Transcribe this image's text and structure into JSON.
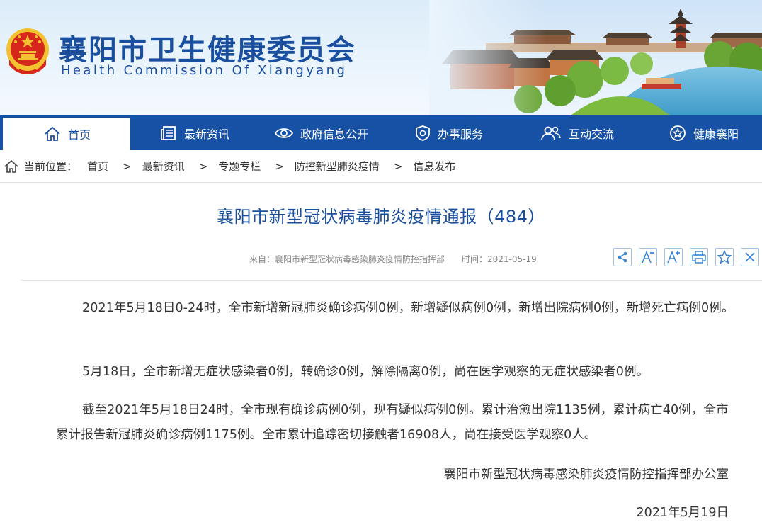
{
  "header": {
    "title": "襄阳市卫生健康委员会",
    "subtitle": "Health Commission Of Xiangyang"
  },
  "nav": {
    "items": [
      {
        "label": "首页",
        "icon": "home-icon"
      },
      {
        "label": "最新资讯",
        "icon": "news-icon"
      },
      {
        "label": "政府信息公开",
        "icon": "eye-icon"
      },
      {
        "label": "办事服务",
        "icon": "shield-icon"
      },
      {
        "label": "互动交流",
        "icon": "users-icon"
      },
      {
        "label": "健康襄阳",
        "icon": "star-icon"
      }
    ],
    "active_index": 0
  },
  "breadcrumb": {
    "prefix": "当前位置：",
    "items": [
      "首页",
      "最新资讯",
      "专题专栏",
      "防控新型肺炎疫情",
      "信息发布"
    ],
    "separator": ">"
  },
  "article": {
    "title": "襄阳市新型冠状病毒肺炎疫情通报（484）",
    "source_label": "来自：襄阳市新型冠状病毒感染肺炎疫情防控指挥部",
    "time_label": "时间：2021-05-19",
    "paragraphs": [
      "2021年5月18日0-24时，全市新增新冠肺炎确诊病例0例，新增疑似病例0例，新增出院病例0例，新增死亡病例0例。",
      "5月18日，全市新增无症状感染者0例，转确诊0例，解除隔离0例，尚在医学观察的无症状感染者0例。",
      "截至2021年5月18日24时，全市现有确诊病例0例，现有疑似病例0例。累计治愈出院1135例，累计病亡40例，全市累计报告新冠肺炎确诊病例1175例。全市累计追踪密切接触者16908人，尚在接受医学观察0人。"
    ],
    "signature": "襄阳市新型冠状病毒感染肺炎疫情防控指挥部办公室",
    "date": "2021年5月19日"
  },
  "tools": [
    "share-icon",
    "font-decrease-icon",
    "font-increase-icon",
    "print-icon",
    "favorite-icon",
    "close-icon"
  ],
  "colors": {
    "brand_blue": "#1751a5",
    "title_blue": "#1a4e9e",
    "emblem_red": "#d7261b",
    "emblem_gold": "#f2c230",
    "tool_border": "#9fc2e7"
  }
}
